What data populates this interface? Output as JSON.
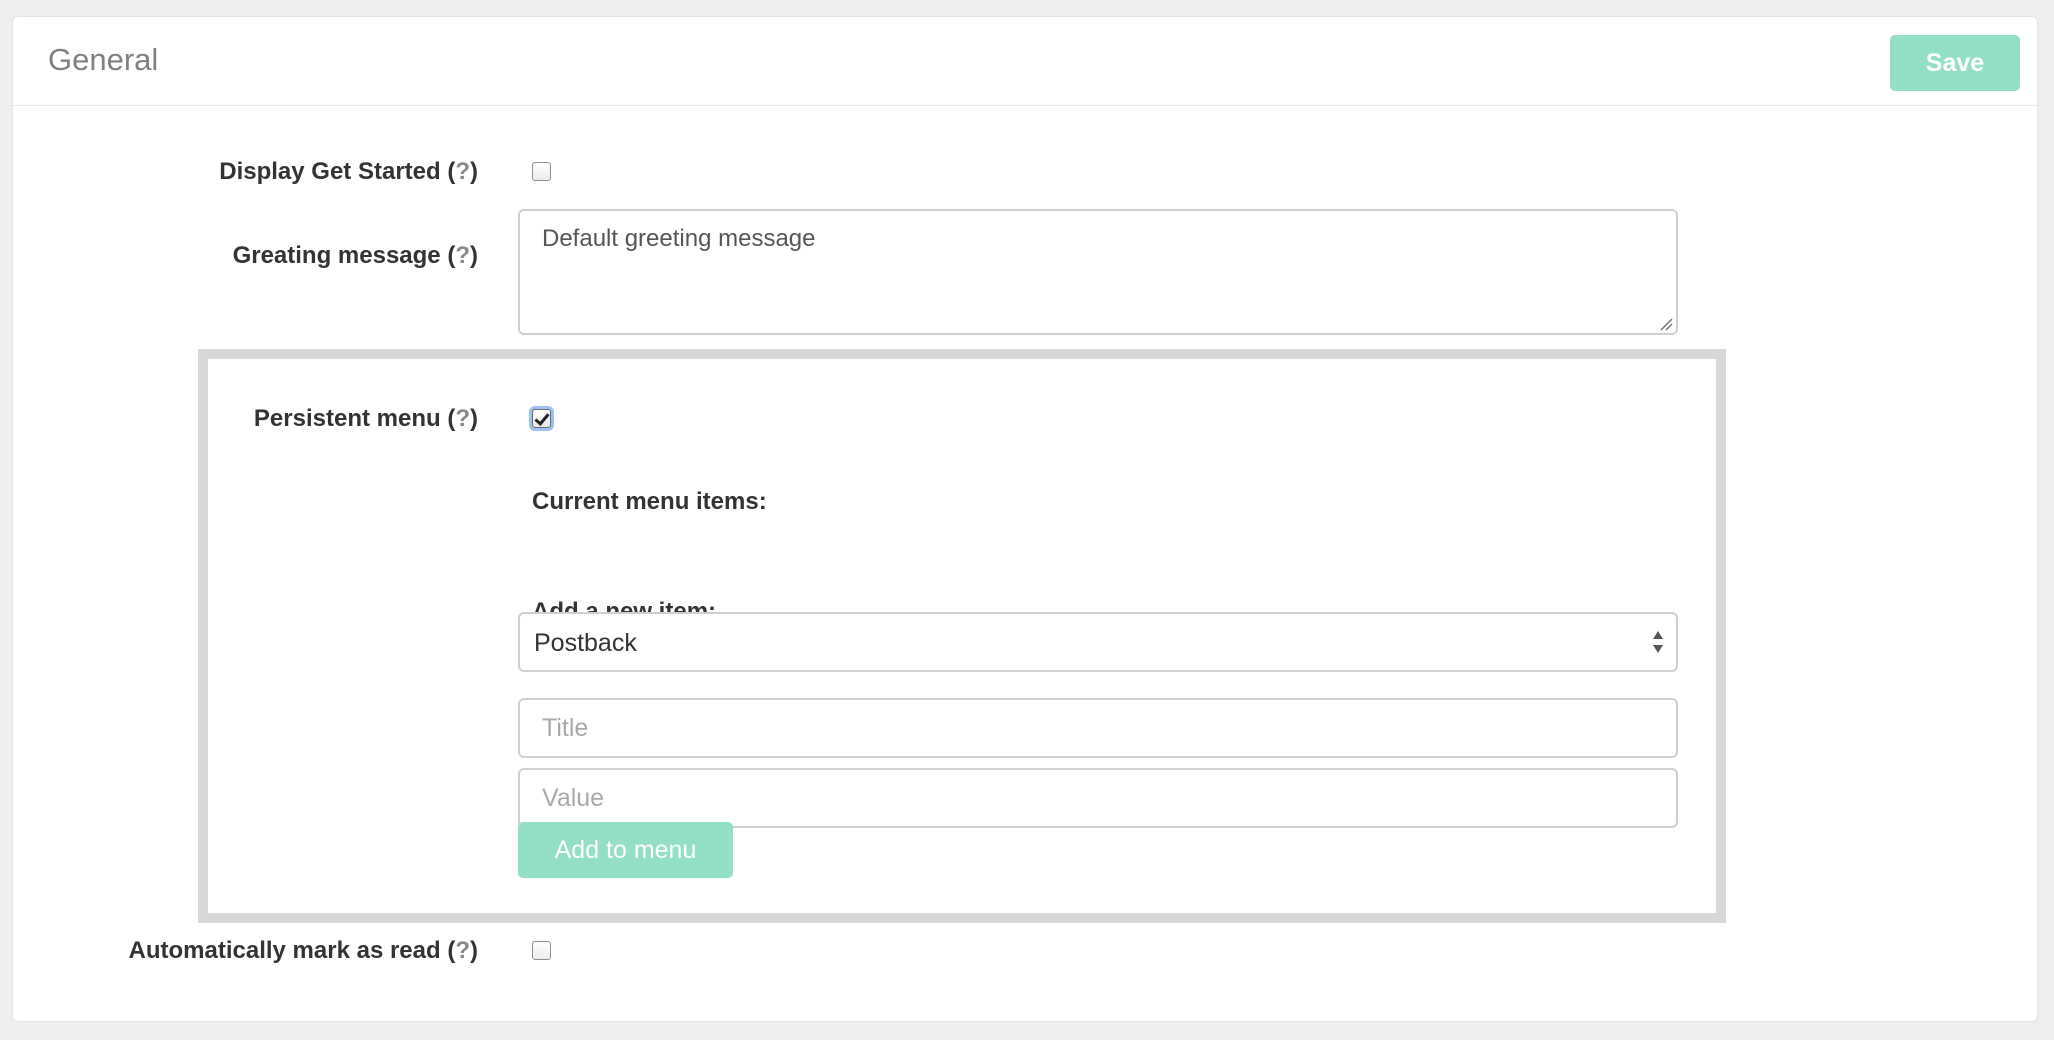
{
  "header": {
    "title": "General",
    "save_label": "Save"
  },
  "help_marker": "?",
  "fields": {
    "display_get_started": {
      "label": "Display Get Started",
      "checked": false
    },
    "greeting_message": {
      "label": "Greating message",
      "value": "Default greeting message"
    },
    "persistent_menu": {
      "label": "Persistent menu",
      "checked": true
    },
    "auto_mark_read": {
      "label": "Automatically mark as read",
      "checked": false
    }
  },
  "menu": {
    "current_items_heading": "Current menu items:",
    "add_item_heading": "Add a new item:",
    "type_select": {
      "value": "Postback"
    },
    "title_input": {
      "placeholder": "Title",
      "value": ""
    },
    "value_input": {
      "placeholder": "Value",
      "value": ""
    },
    "add_label": "Add to menu"
  },
  "colors": {
    "accent_button": "#93dfc8",
    "menu_border": "#d8d8d8"
  }
}
